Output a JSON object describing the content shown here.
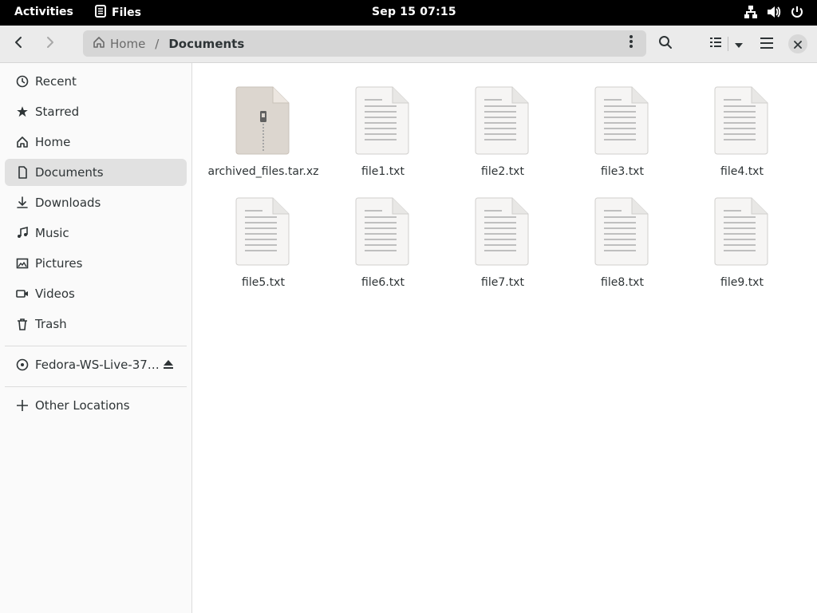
{
  "topbar": {
    "activities": "Activities",
    "app_name": "Files",
    "clock": "Sep 15  07:15",
    "tray_icons": [
      "network-icon",
      "volume-icon",
      "power-icon"
    ]
  },
  "header": {
    "back_icon": "chevron-left-icon",
    "forward_icon": "chevron-right-icon",
    "breadcrumb": {
      "home": "Home",
      "separator": "/",
      "current": "Documents"
    },
    "icons": [
      "search-icon",
      "list-view-icon",
      "dropdown-icon",
      "hamburger-menu-icon",
      "close-icon"
    ]
  },
  "sidebar": {
    "items": [
      {
        "label": "Recent",
        "icon": "clock-icon"
      },
      {
        "label": "Starred",
        "icon": "star-icon"
      },
      {
        "label": "Home",
        "icon": "home-icon"
      },
      {
        "label": "Documents",
        "icon": "document-icon"
      },
      {
        "label": "Downloads",
        "icon": "download-icon"
      },
      {
        "label": "Music",
        "icon": "music-icon"
      },
      {
        "label": "Pictures",
        "icon": "picture-icon"
      },
      {
        "label": "Videos",
        "icon": "video-icon"
      },
      {
        "label": "Trash",
        "icon": "trash-icon"
      }
    ],
    "devices": [
      {
        "label": "Fedora-WS-Live-37…",
        "icon": "disc-icon",
        "action_icon": "eject-icon"
      }
    ],
    "other": {
      "label": "Other Locations",
      "icon": "plus-icon"
    },
    "active": "Documents"
  },
  "files": [
    {
      "name": "archived_files.tar.xz",
      "type": "archive"
    },
    {
      "name": "file1.txt",
      "type": "text"
    },
    {
      "name": "file2.txt",
      "type": "text"
    },
    {
      "name": "file3.txt",
      "type": "text"
    },
    {
      "name": "file4.txt",
      "type": "text"
    },
    {
      "name": "file5.txt",
      "type": "text"
    },
    {
      "name": "file6.txt",
      "type": "text"
    },
    {
      "name": "file7.txt",
      "type": "text"
    },
    {
      "name": "file8.txt",
      "type": "text"
    },
    {
      "name": "file9.txt",
      "type": "text"
    }
  ],
  "colors": {
    "topbar": "#000000",
    "header": "#ebebeb",
    "sidebar": "#fafafa",
    "active_item": "#e1e1e1",
    "archive_icon": "#dcd6cf",
    "text_file_icon": "#f6f5f4"
  }
}
